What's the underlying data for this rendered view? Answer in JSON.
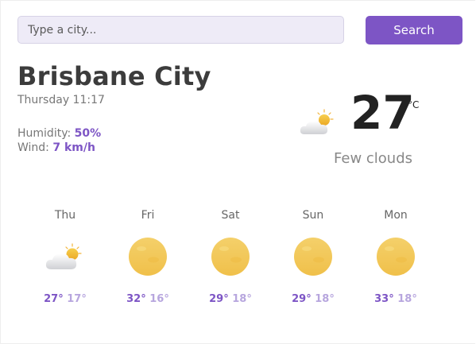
{
  "search": {
    "placeholder": "Type a city...",
    "button_label": "Search"
  },
  "current": {
    "city": "Brisbane City",
    "datetime": "Thursday 11:17",
    "humidity_label": "Humidity: ",
    "humidity_value": "50%",
    "wind_label": "Wind: ",
    "wind_value": "7 km/h",
    "temperature": "27",
    "unit": "°C",
    "description": "Few clouds",
    "icon": "few-clouds-icon"
  },
  "forecast": [
    {
      "day": "Thu",
      "max": "27°",
      "min": "17°",
      "icon": "few-clouds-icon"
    },
    {
      "day": "Fri",
      "max": "32°",
      "min": "16°",
      "icon": "sun-icon"
    },
    {
      "day": "Sat",
      "max": "29°",
      "min": "18°",
      "icon": "sun-icon"
    },
    {
      "day": "Sun",
      "max": "29°",
      "min": "18°",
      "icon": "sun-icon"
    },
    {
      "day": "Mon",
      "max": "33°",
      "min": "18°",
      "icon": "sun-icon"
    }
  ],
  "colors": {
    "accent": "#7d55c5",
    "accent_light": "#b7a6de",
    "input_bg": "#eeebf7",
    "sun": "#f2cc57"
  }
}
